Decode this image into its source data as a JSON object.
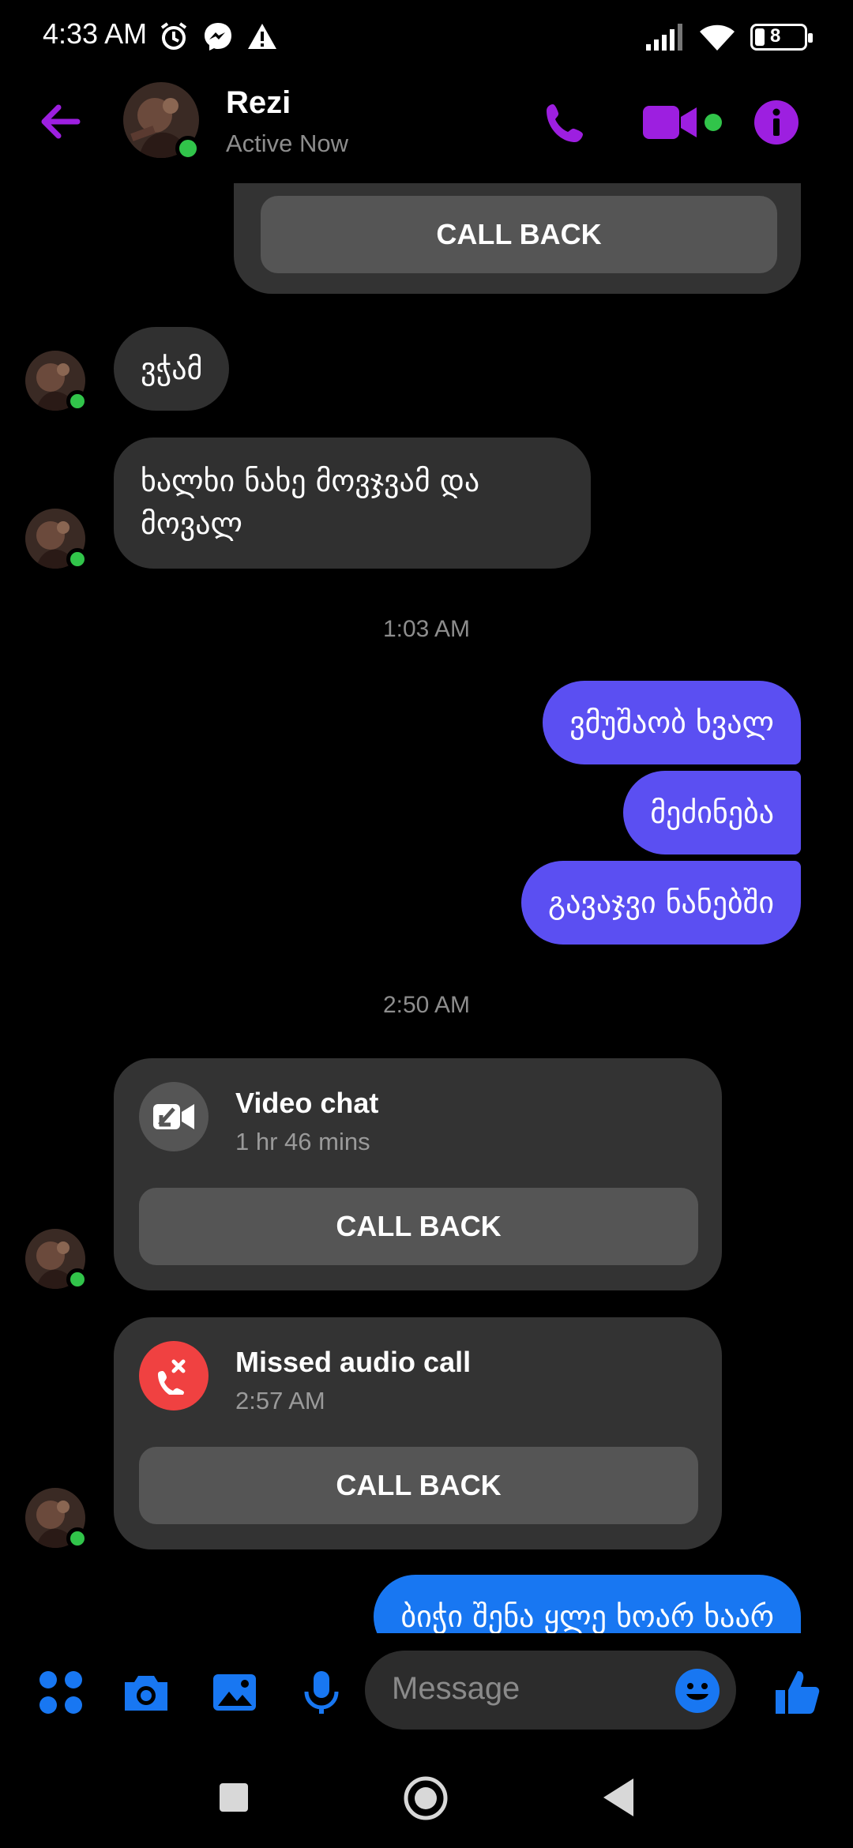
{
  "status_bar": {
    "time": "4:33 AM",
    "battery": "8"
  },
  "header": {
    "contact_name": "Rezi",
    "contact_status": "Active Now"
  },
  "colors": {
    "accent": "#9d1fe0",
    "online": "#31c44a",
    "outgoing_bubble": "#5b4ff2",
    "incoming_bubble": "#303030",
    "messenger_blue": "#1877f2",
    "missed_call": "#f04141"
  },
  "messages": {
    "top_call_back": "CALL BACK",
    "in_1": "ვჭამ",
    "in_2_line1": "ხალხი ნახე მოვჯვამ და",
    "in_2_line2": "მოვალ",
    "time_1": "1:03 AM",
    "out_1": "ვმუშაობ ხვალ",
    "out_2": "მეძინება",
    "out_3": "გავაჯვი ნანებში",
    "time_2": "2:50 AM",
    "out_4": "ბიჭი შენა ყლე ხოარ ხაარ"
  },
  "calls": [
    {
      "icon": "video-off-icon",
      "title": "Video chat",
      "subtitle": "1 hr 46 mins",
      "button": "CALL BACK"
    },
    {
      "icon": "missed-call-icon",
      "title": "Missed audio call",
      "subtitle": "2:57 AM",
      "button": "CALL BACK"
    }
  ],
  "composer": {
    "placeholder": "Message"
  }
}
